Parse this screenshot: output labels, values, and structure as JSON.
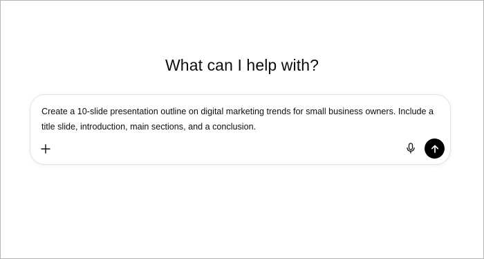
{
  "main": {
    "heading": "What can I help with?"
  },
  "composer": {
    "prompt_text": "Create a 10-slide presentation outline on digital marketing trends for small business owners. Include a title slide, introduction, main sections, and a conclusion.",
    "icons": {
      "attach": "plus-icon",
      "voice": "microphone-icon",
      "send": "arrow-up-icon"
    },
    "colors": {
      "send_background": "#000000",
      "send_icon": "#ffffff",
      "border": "#e3e3e3"
    }
  }
}
